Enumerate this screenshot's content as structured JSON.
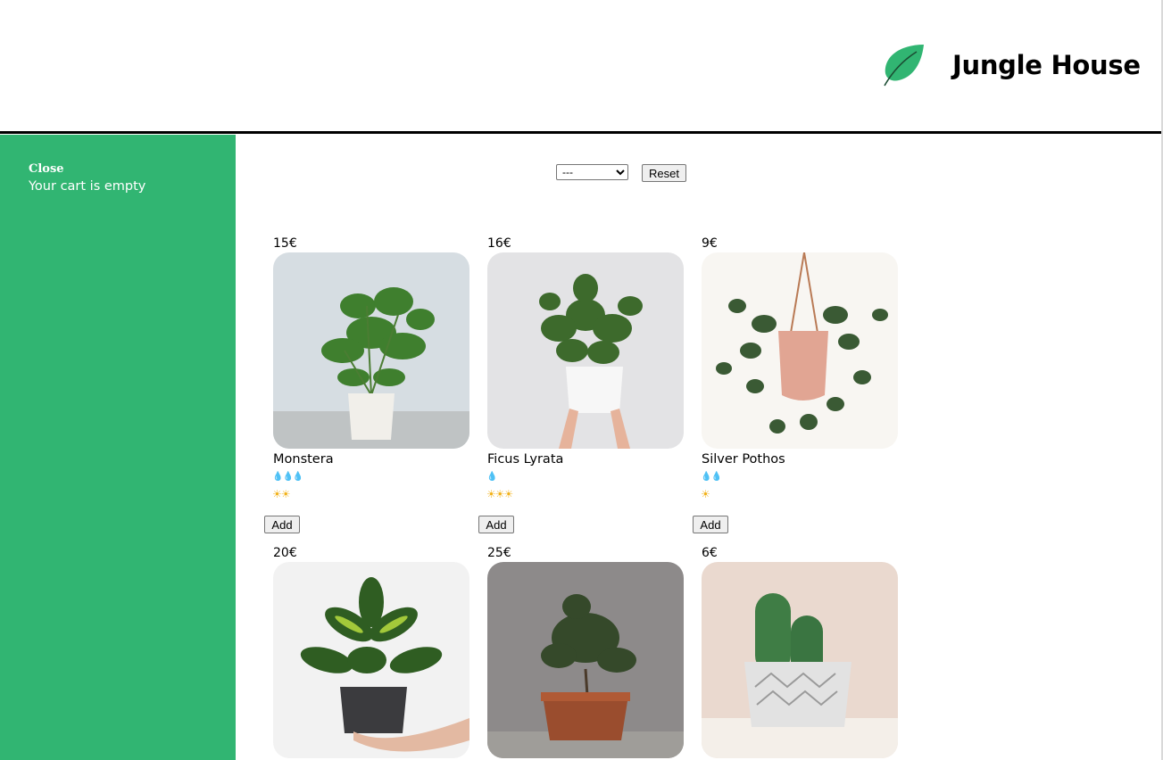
{
  "header": {
    "title": "Jungle House",
    "logo_icon": "leaf-icon",
    "brand_color": "#31b572"
  },
  "cart": {
    "close_label": "Close",
    "empty_text": "Your cart is empty"
  },
  "filter": {
    "selected": "---",
    "reset_label": "Reset"
  },
  "plants": [
    {
      "price": "15€",
      "name": "Monstera",
      "water": "💧💧💧",
      "light": "☀☀",
      "add_label": "Add"
    },
    {
      "price": "16€",
      "name": "Ficus Lyrata",
      "water": "💧",
      "light": "☀☀☀",
      "add_label": "Add"
    },
    {
      "price": "9€",
      "name": "Silver Pothos",
      "water": "💧💧",
      "light": "☀",
      "add_label": "Add"
    },
    {
      "price": "20€",
      "name": "",
      "water": "",
      "light": "",
      "add_label": ""
    },
    {
      "price": "25€",
      "name": "",
      "water": "",
      "light": "",
      "add_label": ""
    },
    {
      "price": "6€",
      "name": "",
      "water": "",
      "light": "",
      "add_label": ""
    }
  ]
}
